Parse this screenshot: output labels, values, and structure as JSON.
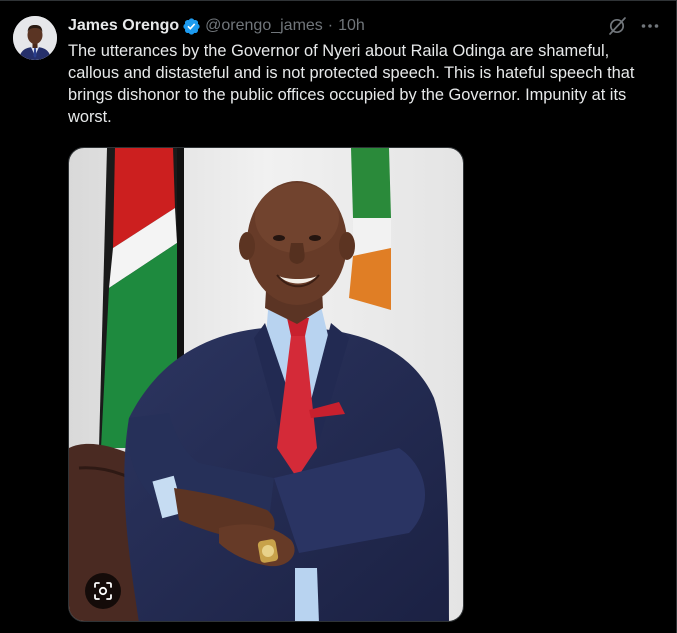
{
  "author": {
    "display_name": "James Orengo",
    "handle": "@orengo_james",
    "separator": "·",
    "timestamp": "10h",
    "verified": true
  },
  "tweet": {
    "text": "The utterances by the Governor of Nyeri about Raila Odinga are shameful, callous and distasteful and is not protected speech. This is hateful speech that brings dishonor to the public offices occupied by the Governor. Impunity at its worst."
  },
  "icons": {
    "verified": "verified-badge-icon",
    "grok": "grok-icon",
    "more": "more-icon",
    "lens": "camera-lens-icon"
  },
  "colors": {
    "background": "#000000",
    "text_primary": "#e7e9ea",
    "text_secondary": "#71767b",
    "verified_blue": "#1d9bf0",
    "border": "#2f3336"
  }
}
